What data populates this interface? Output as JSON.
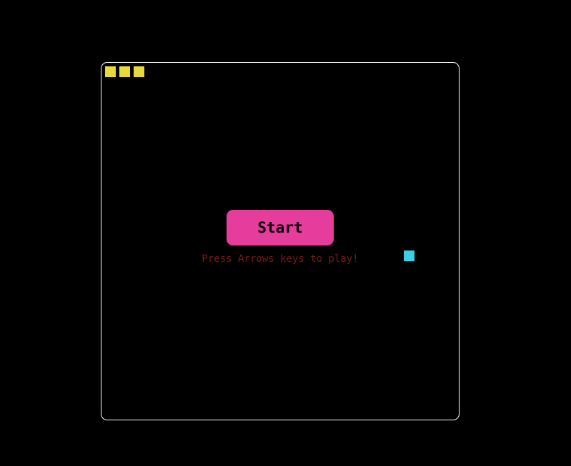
{
  "game": {
    "start_label": "Start",
    "hint_text": "Press Arrows keys to play!",
    "snake_segment_count": 3
  },
  "colors": {
    "background": "#000000",
    "board_border": "#ffffff",
    "snake": "#e8d83a",
    "food": "#3bcfe6",
    "button_bg": "#e63d9c",
    "button_text": "#000000",
    "hint_text": "#7a1a14"
  }
}
